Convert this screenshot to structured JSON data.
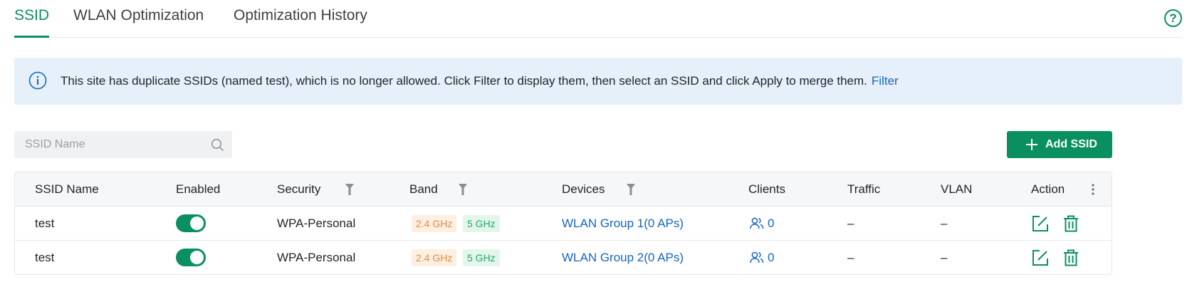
{
  "tabs": [
    {
      "label": "SSID",
      "active": true
    },
    {
      "label": "WLAN Optimization",
      "active": false
    },
    {
      "label": "Optimization History",
      "active": false
    }
  ],
  "help_icon": "?",
  "banner": {
    "message": "This site has duplicate SSIDs (named test), which is no longer allowed. Click Filter to display them, then select an SSID and click Apply to merge them.",
    "link": "Filter"
  },
  "search": {
    "placeholder": "SSID Name"
  },
  "add_button": {
    "label": "Add SSID"
  },
  "table": {
    "columns": [
      "SSID Name",
      "Enabled",
      "Security",
      "Band",
      "Devices",
      "Clients",
      "Traffic",
      "VLAN",
      "Action"
    ],
    "rows": [
      {
        "ssid": "test",
        "enabled": true,
        "security": "WPA-Personal",
        "bands": [
          "2.4 GHz",
          "5 GHz"
        ],
        "devices": "WLAN Group 1(0 APs)",
        "clients": "0",
        "traffic": "–",
        "vlan": "–"
      },
      {
        "ssid": "test",
        "enabled": true,
        "security": "WPA-Personal",
        "bands": [
          "2.4 GHz",
          "5 GHz"
        ],
        "devices": "WLAN Group 2(0 APs)",
        "clients": "0",
        "traffic": "–",
        "vlan": "–"
      }
    ]
  },
  "colors": {
    "accent": "#0a9060",
    "link": "#1565c0",
    "banner_bg": "#e5f0fb",
    "band_24": "#e88a3c",
    "band_5": "#1ea86a"
  }
}
